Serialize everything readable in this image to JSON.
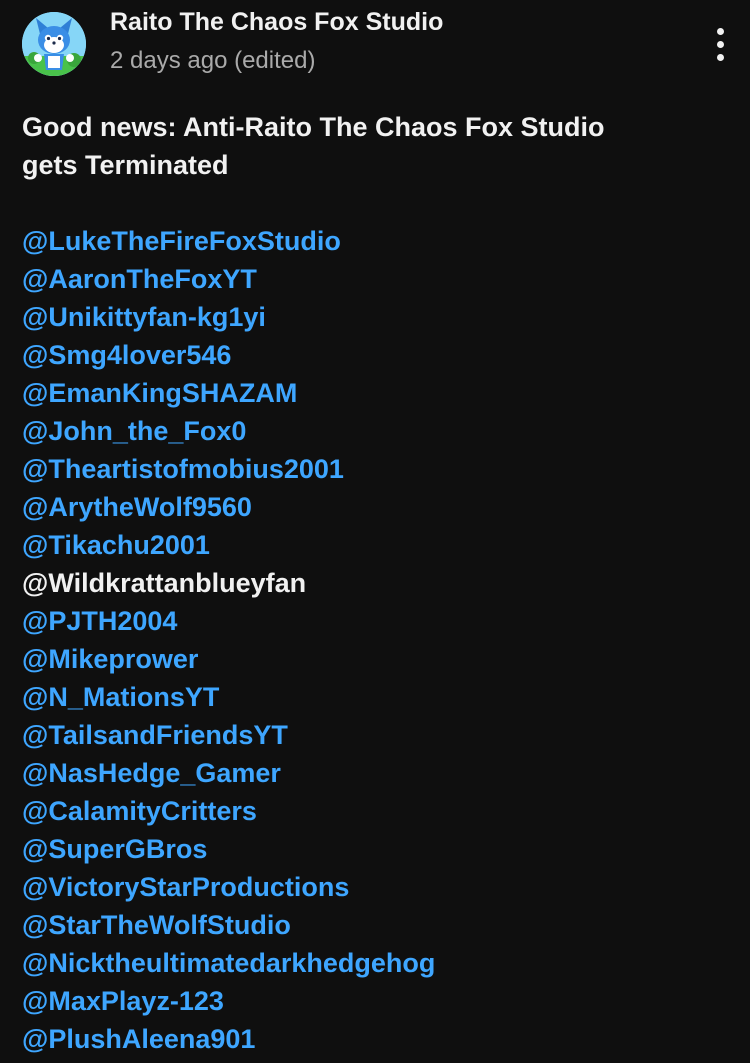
{
  "post": {
    "channel_name": "Raito The Chaos Fox Studio",
    "timestamp": "2 days ago (edited)",
    "avatar_icon": "fox-character-avatar",
    "menu_icon": "more-vert-icon",
    "text_line1": "Good news: Anti-Raito The Chaos Fox Studio",
    "text_line2": "gets Terminated"
  },
  "colors": {
    "background": "#0f0f0f",
    "text": "#f1f1f1",
    "secondary_text": "#aaaaaa",
    "link": "#3ea6ff"
  },
  "mentions": [
    {
      "handle": "@LukeTheFireFoxStudio",
      "linked": true
    },
    {
      "handle": "@AaronTheFoxYT",
      "linked": true
    },
    {
      "handle": "@Unikittyfan-kg1yi",
      "linked": true
    },
    {
      "handle": "@Smg4lover546",
      "linked": true
    },
    {
      "handle": "@EmanKingSHAZAM",
      "linked": true
    },
    {
      "handle": "@John_the_Fox0",
      "linked": true
    },
    {
      "handle": "@Theartistofmobius2001",
      "linked": true
    },
    {
      "handle": "@ArytheWolf9560",
      "linked": true
    },
    {
      "handle": "@Tikachu2001",
      "linked": true
    },
    {
      "handle": "@Wildkrattanblueyfan",
      "linked": false
    },
    {
      "handle": "@PJTH2004",
      "linked": true
    },
    {
      "handle": "@Mikeprower",
      "linked": true
    },
    {
      "handle": "@N_MationsYT",
      "linked": true
    },
    {
      "handle": "@TailsandFriendsYT",
      "linked": true
    },
    {
      "handle": "@NasHedge_Gamer",
      "linked": true
    },
    {
      "handle": "@CalamityCritters",
      "linked": true
    },
    {
      "handle": "@SuperGBros",
      "linked": true
    },
    {
      "handle": "@VictoryStarProductions",
      "linked": true
    },
    {
      "handle": "@StarTheWolfStudio",
      "linked": true
    },
    {
      "handle": "@Nicktheultimatedarkhedgehog",
      "linked": true
    },
    {
      "handle": "@MaxPlayz-123",
      "linked": true
    },
    {
      "handle": "@PlushAleena901",
      "linked": true
    }
  ]
}
